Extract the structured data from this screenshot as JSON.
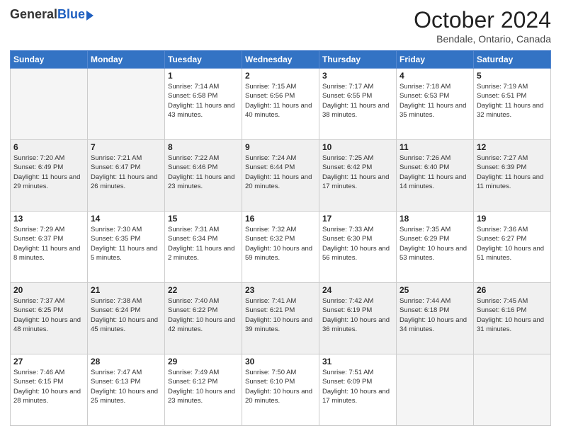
{
  "header": {
    "logo_general": "General",
    "logo_blue": "Blue",
    "month_title": "October 2024",
    "location": "Bendale, Ontario, Canada"
  },
  "days_of_week": [
    "Sunday",
    "Monday",
    "Tuesday",
    "Wednesday",
    "Thursday",
    "Friday",
    "Saturday"
  ],
  "weeks": [
    [
      {
        "day": "",
        "info": "",
        "empty": true
      },
      {
        "day": "",
        "info": "",
        "empty": true
      },
      {
        "day": "1",
        "info": "Sunrise: 7:14 AM\nSunset: 6:58 PM\nDaylight: 11 hours and 43 minutes."
      },
      {
        "day": "2",
        "info": "Sunrise: 7:15 AM\nSunset: 6:56 PM\nDaylight: 11 hours and 40 minutes."
      },
      {
        "day": "3",
        "info": "Sunrise: 7:17 AM\nSunset: 6:55 PM\nDaylight: 11 hours and 38 minutes."
      },
      {
        "day": "4",
        "info": "Sunrise: 7:18 AM\nSunset: 6:53 PM\nDaylight: 11 hours and 35 minutes."
      },
      {
        "day": "5",
        "info": "Sunrise: 7:19 AM\nSunset: 6:51 PM\nDaylight: 11 hours and 32 minutes."
      }
    ],
    [
      {
        "day": "6",
        "info": "Sunrise: 7:20 AM\nSunset: 6:49 PM\nDaylight: 11 hours and 29 minutes."
      },
      {
        "day": "7",
        "info": "Sunrise: 7:21 AM\nSunset: 6:47 PM\nDaylight: 11 hours and 26 minutes."
      },
      {
        "day": "8",
        "info": "Sunrise: 7:22 AM\nSunset: 6:46 PM\nDaylight: 11 hours and 23 minutes."
      },
      {
        "day": "9",
        "info": "Sunrise: 7:24 AM\nSunset: 6:44 PM\nDaylight: 11 hours and 20 minutes."
      },
      {
        "day": "10",
        "info": "Sunrise: 7:25 AM\nSunset: 6:42 PM\nDaylight: 11 hours and 17 minutes."
      },
      {
        "day": "11",
        "info": "Sunrise: 7:26 AM\nSunset: 6:40 PM\nDaylight: 11 hours and 14 minutes."
      },
      {
        "day": "12",
        "info": "Sunrise: 7:27 AM\nSunset: 6:39 PM\nDaylight: 11 hours and 11 minutes."
      }
    ],
    [
      {
        "day": "13",
        "info": "Sunrise: 7:29 AM\nSunset: 6:37 PM\nDaylight: 11 hours and 8 minutes."
      },
      {
        "day": "14",
        "info": "Sunrise: 7:30 AM\nSunset: 6:35 PM\nDaylight: 11 hours and 5 minutes."
      },
      {
        "day": "15",
        "info": "Sunrise: 7:31 AM\nSunset: 6:34 PM\nDaylight: 11 hours and 2 minutes."
      },
      {
        "day": "16",
        "info": "Sunrise: 7:32 AM\nSunset: 6:32 PM\nDaylight: 10 hours and 59 minutes."
      },
      {
        "day": "17",
        "info": "Sunrise: 7:33 AM\nSunset: 6:30 PM\nDaylight: 10 hours and 56 minutes."
      },
      {
        "day": "18",
        "info": "Sunrise: 7:35 AM\nSunset: 6:29 PM\nDaylight: 10 hours and 53 minutes."
      },
      {
        "day": "19",
        "info": "Sunrise: 7:36 AM\nSunset: 6:27 PM\nDaylight: 10 hours and 51 minutes."
      }
    ],
    [
      {
        "day": "20",
        "info": "Sunrise: 7:37 AM\nSunset: 6:25 PM\nDaylight: 10 hours and 48 minutes."
      },
      {
        "day": "21",
        "info": "Sunrise: 7:38 AM\nSunset: 6:24 PM\nDaylight: 10 hours and 45 minutes."
      },
      {
        "day": "22",
        "info": "Sunrise: 7:40 AM\nSunset: 6:22 PM\nDaylight: 10 hours and 42 minutes."
      },
      {
        "day": "23",
        "info": "Sunrise: 7:41 AM\nSunset: 6:21 PM\nDaylight: 10 hours and 39 minutes."
      },
      {
        "day": "24",
        "info": "Sunrise: 7:42 AM\nSunset: 6:19 PM\nDaylight: 10 hours and 36 minutes."
      },
      {
        "day": "25",
        "info": "Sunrise: 7:44 AM\nSunset: 6:18 PM\nDaylight: 10 hours and 34 minutes."
      },
      {
        "day": "26",
        "info": "Sunrise: 7:45 AM\nSunset: 6:16 PM\nDaylight: 10 hours and 31 minutes."
      }
    ],
    [
      {
        "day": "27",
        "info": "Sunrise: 7:46 AM\nSunset: 6:15 PM\nDaylight: 10 hours and 28 minutes."
      },
      {
        "day": "28",
        "info": "Sunrise: 7:47 AM\nSunset: 6:13 PM\nDaylight: 10 hours and 25 minutes."
      },
      {
        "day": "29",
        "info": "Sunrise: 7:49 AM\nSunset: 6:12 PM\nDaylight: 10 hours and 23 minutes."
      },
      {
        "day": "30",
        "info": "Sunrise: 7:50 AM\nSunset: 6:10 PM\nDaylight: 10 hours and 20 minutes."
      },
      {
        "day": "31",
        "info": "Sunrise: 7:51 AM\nSunset: 6:09 PM\nDaylight: 10 hours and 17 minutes."
      },
      {
        "day": "",
        "info": "",
        "empty": true
      },
      {
        "day": "",
        "info": "",
        "empty": true
      }
    ]
  ]
}
